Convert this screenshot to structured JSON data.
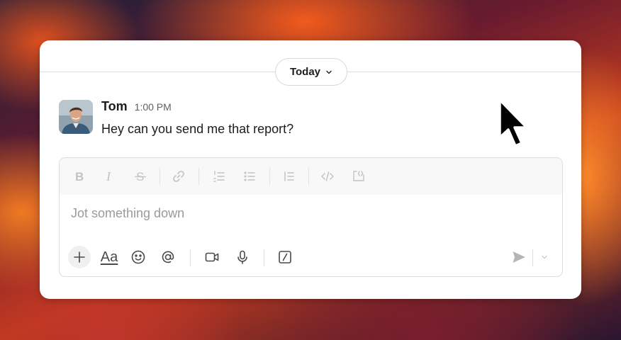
{
  "date_divider": {
    "label": "Today"
  },
  "message": {
    "author": "Tom",
    "time": "1:00 PM",
    "text": "Hey can you send me that report?"
  },
  "composer": {
    "placeholder": "Jot something down",
    "format_toolbar": [
      "bold-icon",
      "italic-icon",
      "strikethrough-icon",
      "link-icon",
      "ordered-list-icon",
      "bulleted-list-icon",
      "blockquote-icon",
      "code-icon",
      "code-block-icon"
    ],
    "bottom_toolbar": {
      "format_label": "Aa",
      "icons": [
        "plus-icon",
        "emoji-icon",
        "mention-icon",
        "video-icon",
        "microphone-icon",
        "slash-command-icon",
        "send-icon",
        "chevron-down-icon"
      ]
    }
  },
  "colors": {
    "accent_text": "#1d1c1d",
    "muted_text": "#616061",
    "disabled_icon": "#c3c3c3"
  }
}
